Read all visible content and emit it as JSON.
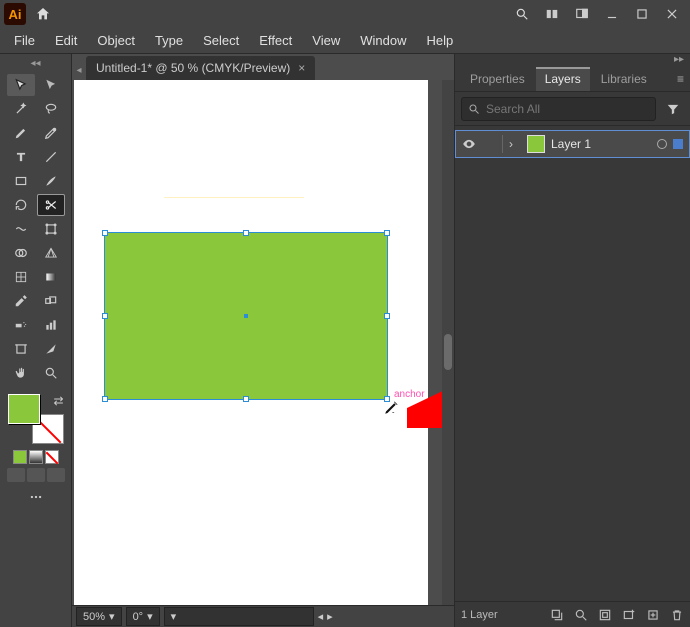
{
  "app": {
    "logo_text": "Ai"
  },
  "menus": {
    "file": "File",
    "edit": "Edit",
    "object": "Object",
    "type": "Type",
    "select": "Select",
    "effect": "Effect",
    "view": "View",
    "window": "Window",
    "help": "Help"
  },
  "doc_tab": {
    "title": "Untitled-1* @ 50 % (CMYK/Preview)",
    "close": "×"
  },
  "canvas": {
    "anchor_label": "anchor",
    "selected_shape": {
      "type": "rectangle",
      "fill": "#8bc73b"
    }
  },
  "statusbar": {
    "zoom": "50%",
    "rotation": "0°"
  },
  "panels": {
    "properties": "Properties",
    "layers": "Layers",
    "libraries": "Libraries",
    "search_placeholder": "Search All",
    "layer1_name": "Layer 1",
    "footer_count": "1 Layer"
  },
  "icons": {
    "search": "search",
    "filter": "filter",
    "home": "home",
    "panel_menu": "menu"
  },
  "colors": {
    "accent": "#8bc73b",
    "selection": "#2b8dd6",
    "annotation": "#ff4fb0"
  }
}
